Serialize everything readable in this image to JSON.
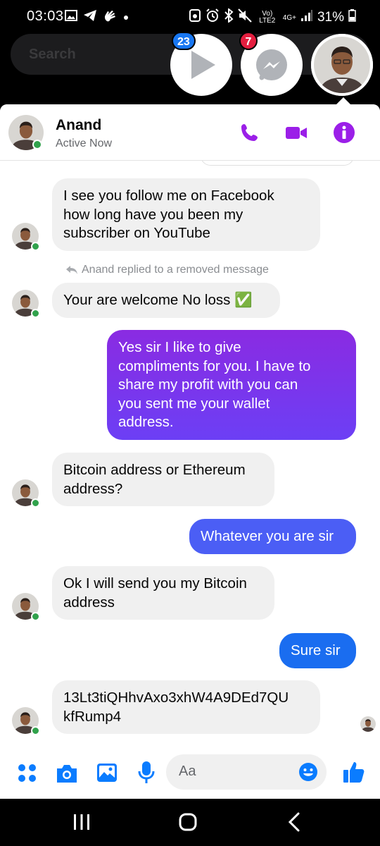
{
  "status_bar": {
    "time": "03:03",
    "battery": "31%",
    "network": "Vo) LTE2",
    "network_gen": "4G+"
  },
  "search": {
    "placeholder": "Search"
  },
  "chat_heads": [
    {
      "name": "play-app-head",
      "badge": "23",
      "badge_color": "#1877f2"
    },
    {
      "name": "messenger-head",
      "badge": "7",
      "badge_color": "#e41e3f"
    },
    {
      "name": "anand-head"
    }
  ],
  "header": {
    "name": "Anand",
    "status": "Active Now"
  },
  "messages": [
    {
      "direction": "in",
      "text": "I see you follow me on Facebook\nhow long have you been my\nsubscriber on YouTube"
    },
    {
      "direction": "note",
      "text": "Anand replied to a removed message"
    },
    {
      "direction": "in",
      "text": "Your are welcome No loss ✅"
    },
    {
      "direction": "out",
      "text": "Yes sir I like to give\ncompliments for you. I have to\nshare my profit with you can\nyou sent me your wallet\naddress."
    },
    {
      "direction": "in",
      "text": "Bitcoin address or Ethereum\naddress?"
    },
    {
      "direction": "out",
      "text": "Whatever you are sir"
    },
    {
      "direction": "in",
      "text": "Ok I will send you my Bitcoin\naddress"
    },
    {
      "direction": "out",
      "text": "Sure sir"
    },
    {
      "direction": "in",
      "text": "13Lt3tiQHhvAxo3xhW4A9DEd7QU\nkfRump4"
    }
  ],
  "composer": {
    "placeholder": "Aa"
  },
  "colors": {
    "accent": "#9b1fe8",
    "messenger_blue": "#0a7cff",
    "purple_bubble": "#7b3ff2",
    "incoming_bubble": "#f0f0f0",
    "online": "#31a24c"
  }
}
